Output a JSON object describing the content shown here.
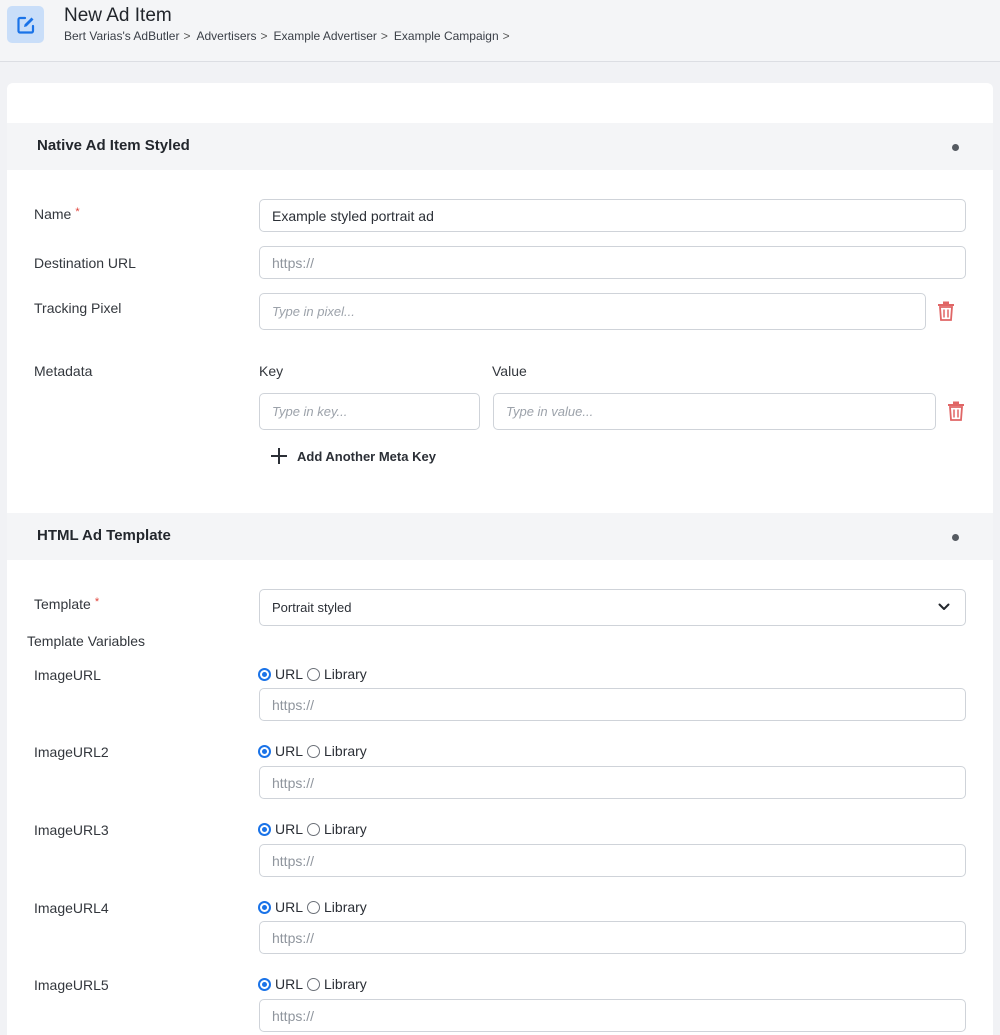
{
  "header": {
    "title": "New Ad Item",
    "icon": "edit-icon",
    "accent": "#1a73e8",
    "breadcrumb": [
      "Bert Varias's AdButler",
      "Advertisers",
      "Example Advertiser",
      "Example Campaign"
    ],
    "separator": ">"
  },
  "native_section": {
    "title": "Native Ad Item Styled",
    "name": {
      "label": "Name",
      "required_mark": "*",
      "value": "Example styled portrait ad"
    },
    "destination_url": {
      "label": "Destination URL",
      "placeholder": "https://"
    },
    "tracking_pixel": {
      "label": "Tracking Pixel",
      "placeholder": "Type in pixel...",
      "delete_icon": "trash-icon"
    },
    "metadata": {
      "label": "Metadata",
      "key_header": "Key",
      "value_header": "Value",
      "key_placeholder": "Type in key...",
      "value_placeholder": "Type in value...",
      "add_label": "Add Another Meta Key",
      "delete_icon": "trash-icon"
    }
  },
  "template_section": {
    "title": "HTML Ad Template",
    "template": {
      "label": "Template",
      "required_mark": "*",
      "selected": "Portrait styled"
    },
    "variables_label": "Template Variables",
    "radio_url": "URL",
    "radio_library": "Library",
    "variables": [
      {
        "label": "ImageURL",
        "placeholder": "https://",
        "selected": "URL"
      },
      {
        "label": "ImageURL2",
        "placeholder": "https://",
        "selected": "URL"
      },
      {
        "label": "ImageURL3",
        "placeholder": "https://",
        "selected": "URL"
      },
      {
        "label": "ImageURL4",
        "placeholder": "https://",
        "selected": "URL"
      },
      {
        "label": "ImageURL5",
        "placeholder": "https://",
        "selected": "URL"
      }
    ]
  },
  "colors": {
    "required": "#e0443c",
    "delete": "#e06666",
    "radio": "#1a73e8"
  }
}
